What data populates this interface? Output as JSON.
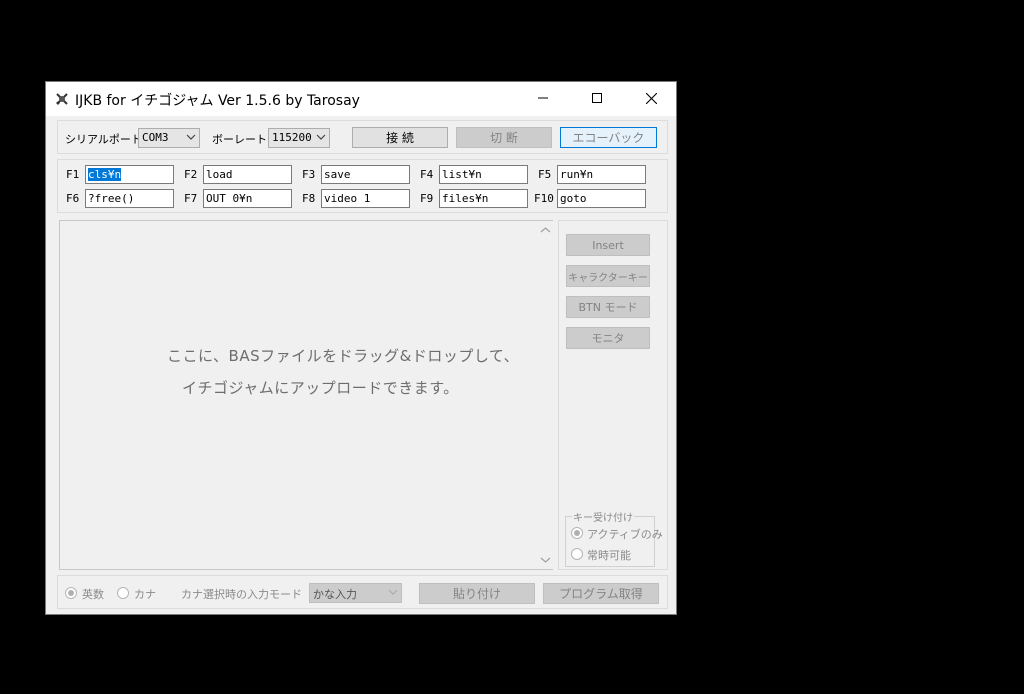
{
  "window": {
    "title": "IJKB for イチゴジャム Ver 1.5.6   by Tarosay"
  },
  "connection": {
    "serial_port_label": "シリアルポート",
    "serial_port_value": "COM3",
    "baud_label": "ボーレート",
    "baud_value": "115200",
    "connect_label": "接 続",
    "disconnect_label": "切 断",
    "echoback_label": "エコーバック"
  },
  "fkeys": [
    {
      "label": "F1",
      "value": "cls¥n"
    },
    {
      "label": "F2",
      "value": "load"
    },
    {
      "label": "F3",
      "value": "save"
    },
    {
      "label": "F4",
      "value": "list¥n"
    },
    {
      "label": "F5",
      "value": "run¥n"
    },
    {
      "label": "F6",
      "value": "?free()"
    },
    {
      "label": "F7",
      "value": "OUT 0¥n"
    },
    {
      "label": "F8",
      "value": "video 1"
    },
    {
      "label": "F9",
      "value": "files¥n"
    },
    {
      "label": "F10",
      "value": "goto"
    }
  ],
  "dropzone": {
    "line1": "ここに、BASファイルをドラッグ&ドロップして、",
    "line2": "イチゴジャムにアップロードできます。"
  },
  "side_buttons": {
    "insert": "Insert",
    "char_key": "キャラクターキー",
    "btn_mode": "BTN モード",
    "monitor": "モニタ"
  },
  "key_accept": {
    "title": "キー受け付け",
    "active_only": "アクティブのみ",
    "always": "常時可能",
    "selected": "active_only"
  },
  "bottom": {
    "eisu": "英数",
    "kana": "カナ",
    "mode_label": "カナ選択時の入力モード",
    "mode_value": "かな入力",
    "paste": "貼り付け",
    "get_program": "プログラム取得",
    "selected": "eisu"
  }
}
